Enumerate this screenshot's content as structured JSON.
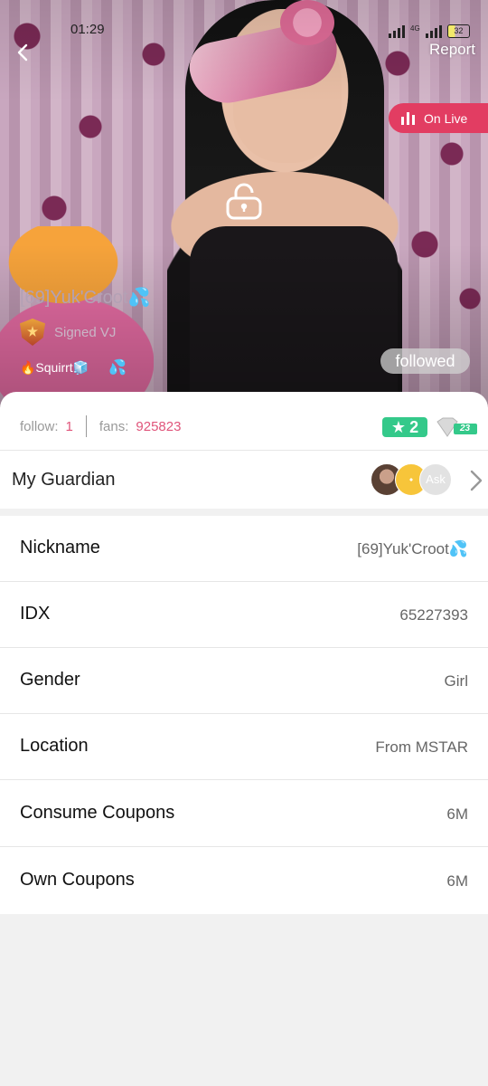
{
  "status_bar": {
    "time": "01:29",
    "network": "4G",
    "battery": "32"
  },
  "header": {
    "report_label": "Report",
    "live_label": "On Live"
  },
  "host": {
    "name": "[69]Yuk'Croot💦",
    "signed_label": "Signed VJ",
    "tag": "🔥Squirrt🧊",
    "followed_label": "followed"
  },
  "stats": {
    "follow_label": "follow:",
    "follow_value": "1",
    "fans_label": "fans:",
    "fans_value": "925823",
    "level_value": "2",
    "vip_level": "23"
  },
  "guardian": {
    "label": "My Guardian",
    "ask_label": "Ask"
  },
  "info_rows": [
    {
      "label": "Nickname",
      "value": "[69]Yuk'Croot💦"
    },
    {
      "label": "IDX",
      "value": "65227393"
    },
    {
      "label": "Gender",
      "value": "Girl"
    },
    {
      "label": "Location",
      "value": "From MSTAR"
    },
    {
      "label": "Consume Coupons",
      "value": "6M"
    },
    {
      "label": "Own Coupons",
      "value": "6M"
    }
  ],
  "colors": {
    "accent": "#e23d62",
    "fans_value": "#e0557b",
    "level_green": "#34c98a"
  },
  "icons": [
    "back-arrow-icon",
    "live-bars-icon",
    "lock-icon",
    "shield-icon",
    "drops-icon",
    "star-icon",
    "diamond-icon",
    "chevron-right-icon"
  ]
}
